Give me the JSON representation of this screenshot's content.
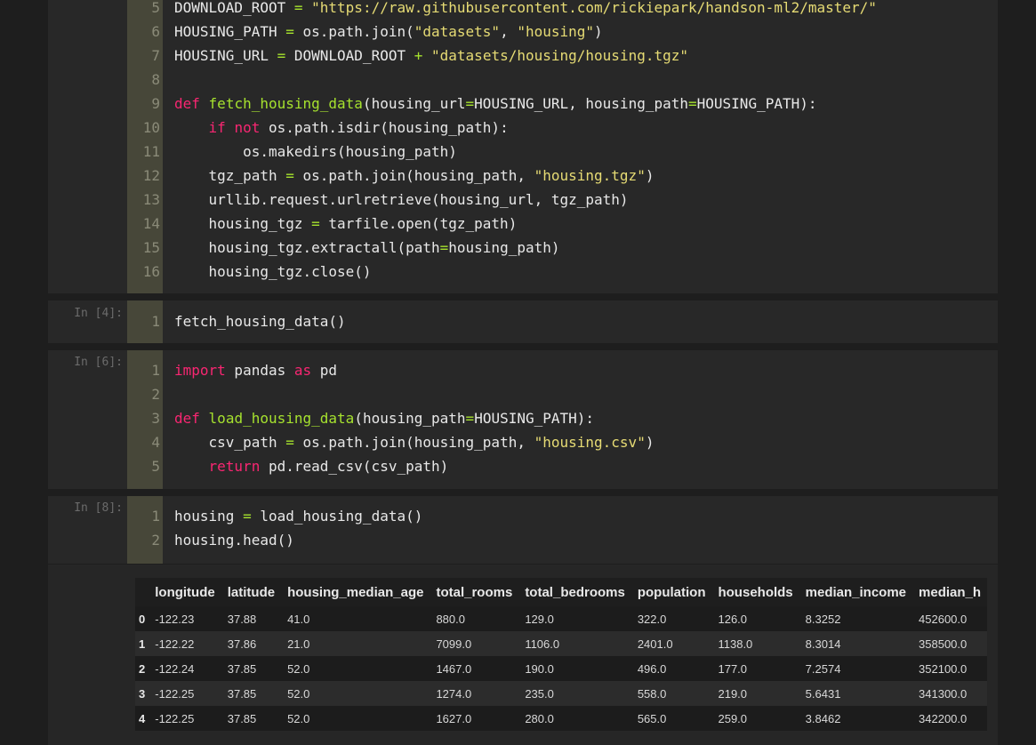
{
  "cells": [
    {
      "prompt": "",
      "lines": [
        {
          "n": "5",
          "tokens": [
            [
              "DOWNLOAD_ROOT ",
              ""
            ],
            [
              "=",
              "op"
            ],
            [
              " ",
              ""
            ],
            [
              "\"https://raw.githubusercontent.com/rickiepark/handson-ml2/master/\"",
              "str"
            ]
          ]
        },
        {
          "n": "6",
          "tokens": [
            [
              "HOUSING_PATH ",
              ""
            ],
            [
              "=",
              "op"
            ],
            [
              " os.path.join(",
              ""
            ],
            [
              "\"datasets\"",
              "str"
            ],
            [
              ", ",
              ""
            ],
            [
              "\"housing\"",
              "str"
            ],
            [
              ")",
              ""
            ]
          ]
        },
        {
          "n": "7",
          "tokens": [
            [
              "HOUSING_URL ",
              ""
            ],
            [
              "=",
              "op"
            ],
            [
              " DOWNLOAD_ROOT ",
              ""
            ],
            [
              "+",
              "op"
            ],
            [
              " ",
              ""
            ],
            [
              "\"datasets/housing/housing.tgz\"",
              "str"
            ]
          ]
        },
        {
          "n": "8",
          "tokens": []
        },
        {
          "n": "9",
          "tokens": [
            [
              "def",
              "kw"
            ],
            [
              " ",
              ""
            ],
            [
              "fetch_housing_data",
              "fn"
            ],
            [
              "(housing_url",
              ""
            ],
            [
              "=",
              "op"
            ],
            [
              "HOUSING_URL, housing_path",
              ""
            ],
            [
              "=",
              "op"
            ],
            [
              "HOUSING_PATH):",
              ""
            ]
          ]
        },
        {
          "n": "10",
          "tokens": [
            [
              "    ",
              ""
            ],
            [
              "if",
              "kw"
            ],
            [
              " ",
              ""
            ],
            [
              "not",
              "kw"
            ],
            [
              " os.path.isdir(housing_path):",
              ""
            ]
          ]
        },
        {
          "n": "11",
          "tokens": [
            [
              "        os.makedirs(housing_path)",
              ""
            ]
          ]
        },
        {
          "n": "12",
          "tokens": [
            [
              "    tgz_path ",
              ""
            ],
            [
              "=",
              "op"
            ],
            [
              " os.path.join(housing_path, ",
              ""
            ],
            [
              "\"housing.tgz\"",
              "str"
            ],
            [
              ")",
              ""
            ]
          ]
        },
        {
          "n": "13",
          "tokens": [
            [
              "    urllib.request.urlretrieve(housing_url, tgz_path)",
              ""
            ]
          ]
        },
        {
          "n": "14",
          "tokens": [
            [
              "    housing_tgz ",
              ""
            ],
            [
              "=",
              "op"
            ],
            [
              " tarfile.open(tgz_path)",
              ""
            ]
          ]
        },
        {
          "n": "15",
          "tokens": [
            [
              "    housing_tgz.extractall(path",
              ""
            ],
            [
              "=",
              "op"
            ],
            [
              "housing_path)",
              ""
            ]
          ]
        },
        {
          "n": "16",
          "tokens": [
            [
              "    housing_tgz.close()",
              ""
            ]
          ]
        }
      ]
    },
    {
      "prompt": "In [4]:",
      "lines": [
        {
          "n": "1",
          "tokens": [
            [
              "fetch_housing_data()",
              ""
            ]
          ]
        }
      ]
    },
    {
      "prompt": "In [6]:",
      "lines": [
        {
          "n": "1",
          "tokens": [
            [
              "import",
              "kw"
            ],
            [
              " pandas ",
              ""
            ],
            [
              "as",
              "kw"
            ],
            [
              " pd",
              ""
            ]
          ]
        },
        {
          "n": "2",
          "tokens": []
        },
        {
          "n": "3",
          "tokens": [
            [
              "def",
              "kw"
            ],
            [
              " ",
              ""
            ],
            [
              "load_housing_data",
              "fn"
            ],
            [
              "(housing_path",
              ""
            ],
            [
              "=",
              "op"
            ],
            [
              "HOUSING_PATH):",
              ""
            ]
          ]
        },
        {
          "n": "4",
          "tokens": [
            [
              "    csv_path ",
              ""
            ],
            [
              "=",
              "op"
            ],
            [
              " os.path.join(housing_path, ",
              ""
            ],
            [
              "\"housing.csv\"",
              "str"
            ],
            [
              ")",
              ""
            ]
          ]
        },
        {
          "n": "5",
          "tokens": [
            [
              "    ",
              ""
            ],
            [
              "return",
              "kw"
            ],
            [
              " pd.read_csv(csv_path)",
              ""
            ]
          ]
        }
      ]
    },
    {
      "prompt": "In [8]:",
      "lines": [
        {
          "n": "1",
          "tokens": [
            [
              "housing ",
              ""
            ],
            [
              "=",
              "op"
            ],
            [
              " load_housing_data()",
              ""
            ]
          ]
        },
        {
          "n": "2",
          "tokens": [
            [
              "housing.head()",
              ""
            ]
          ]
        }
      ]
    }
  ],
  "table": {
    "columns": [
      "",
      "longitude",
      "latitude",
      "housing_median_age",
      "total_rooms",
      "total_bedrooms",
      "population",
      "households",
      "median_income",
      "median_h"
    ],
    "rows": [
      [
        "0",
        "-122.23",
        "37.88",
        "41.0",
        "880.0",
        "129.0",
        "322.0",
        "126.0",
        "8.3252",
        "452600.0"
      ],
      [
        "1",
        "-122.22",
        "37.86",
        "21.0",
        "7099.0",
        "1106.0",
        "2401.0",
        "1138.0",
        "8.3014",
        "358500.0"
      ],
      [
        "2",
        "-122.24",
        "37.85",
        "52.0",
        "1467.0",
        "190.0",
        "496.0",
        "177.0",
        "7.2574",
        "352100.0"
      ],
      [
        "3",
        "-122.25",
        "37.85",
        "52.0",
        "1274.0",
        "235.0",
        "558.0",
        "219.0",
        "5.6431",
        "341300.0"
      ],
      [
        "4",
        "-122.25",
        "37.85",
        "52.0",
        "1627.0",
        "280.0",
        "565.0",
        "259.0",
        "3.8462",
        "342200.0"
      ]
    ]
  },
  "colors": {
    "keyword": "#f92672",
    "function": "#a6e22e",
    "string": "#e6db74",
    "background": "#1e1e1e"
  }
}
